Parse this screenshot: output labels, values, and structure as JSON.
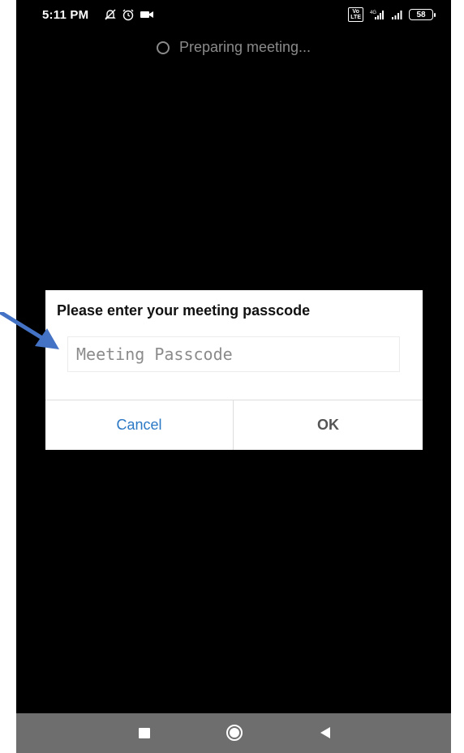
{
  "status_bar": {
    "time": "5:11 PM",
    "left_icons": [
      "mute-icon",
      "alarm-icon",
      "video-icon"
    ],
    "right_icons": [
      "volte-icon",
      "4g-signal-icon",
      "signal-icon",
      "battery-icon"
    ],
    "volte_label": "Vo\nLTE",
    "battery_level": "58"
  },
  "loading": {
    "text": "Preparing meeting..."
  },
  "dialog": {
    "title": "Please enter your meeting passcode",
    "input": {
      "placeholder": "Meeting Passcode",
      "value": ""
    },
    "cancel_label": "Cancel",
    "ok_label": "OK"
  },
  "nav_bar": {
    "buttons": [
      "recents-icon",
      "home-icon",
      "back-icon"
    ]
  },
  "colors": {
    "screen_bg": "#000000",
    "dialog_bg": "#ffffff",
    "cancel_text": "#2b78c5",
    "ok_text": "#555555",
    "nav_bg": "#6e6e6e",
    "annotation_arrow": "#4472c4"
  }
}
